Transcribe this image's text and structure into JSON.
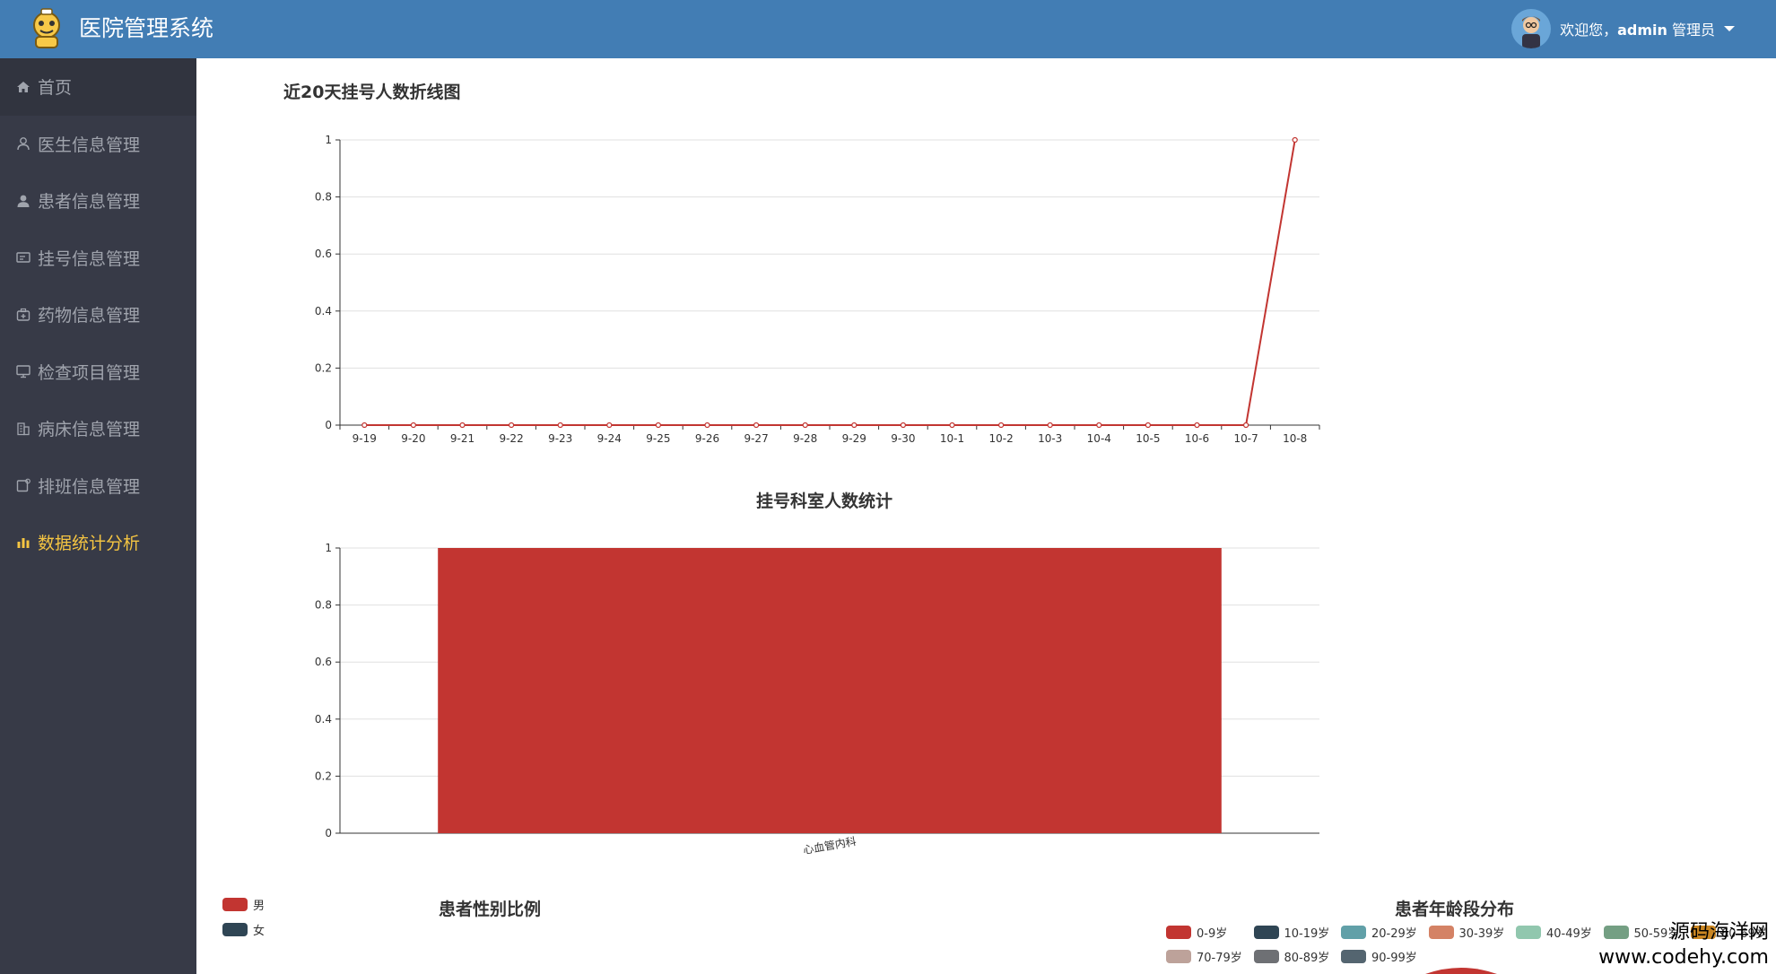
{
  "header": {
    "app_title": "医院管理系统",
    "welcome_prefix": "欢迎您，",
    "username": "admin",
    "role": " 管理员"
  },
  "sidebar": {
    "items": [
      {
        "label": "首页",
        "icon": "home-icon"
      },
      {
        "label": "医生信息管理",
        "icon": "user-outline-icon"
      },
      {
        "label": "患者信息管理",
        "icon": "user-icon"
      },
      {
        "label": "挂号信息管理",
        "icon": "id-card-icon"
      },
      {
        "label": "药物信息管理",
        "icon": "medicine-box-icon"
      },
      {
        "label": "检查项目管理",
        "icon": "monitor-icon"
      },
      {
        "label": "病床信息管理",
        "icon": "building-icon"
      },
      {
        "label": "排班信息管理",
        "icon": "calendar-icon"
      },
      {
        "label": "数据统计分析",
        "icon": "bar-chart-icon"
      }
    ],
    "active_index": 8
  },
  "colors": {
    "header_bg": "#427db4",
    "sidebar_bg": "#373a47",
    "active": "#f5c542",
    "series_red": "#c23531"
  },
  "chart_data": [
    {
      "type": "line",
      "title": "近20天挂号人数折线图",
      "categories": [
        "9-19",
        "9-20",
        "9-21",
        "9-22",
        "9-23",
        "9-24",
        "9-25",
        "9-26",
        "9-27",
        "9-28",
        "9-29",
        "9-30",
        "10-1",
        "10-2",
        "10-3",
        "10-4",
        "10-5",
        "10-6",
        "10-7",
        "10-8"
      ],
      "values": [
        0,
        0,
        0,
        0,
        0,
        0,
        0,
        0,
        0,
        0,
        0,
        0,
        0,
        0,
        0,
        0,
        0,
        0,
        0,
        1
      ],
      "ylim": [
        0,
        1
      ],
      "yticks": [
        "0",
        "0.2",
        "0.4",
        "0.6",
        "0.8",
        "1"
      ],
      "grid": true
    },
    {
      "type": "bar",
      "title": "挂号科室人数统计",
      "categories": [
        "心血管内科"
      ],
      "values": [
        1
      ],
      "ylim": [
        0,
        1
      ],
      "yticks": [
        "0",
        "0.2",
        "0.4",
        "0.6",
        "0.8",
        "1"
      ],
      "grid": true
    },
    {
      "type": "pie",
      "title": "患者性别比例",
      "legend": [
        {
          "label": "男",
          "color": "#c23531"
        },
        {
          "label": "女",
          "color": "#2f4554"
        }
      ],
      "legend_position": "top-left"
    },
    {
      "type": "pie",
      "title": "患者年龄段分布",
      "legend": [
        {
          "label": "0-9岁",
          "color": "#c23531"
        },
        {
          "label": "10-19岁",
          "color": "#2f4554"
        },
        {
          "label": "20-29岁",
          "color": "#61a0a8"
        },
        {
          "label": "30-39岁",
          "color": "#d48265"
        },
        {
          "label": "40-49岁",
          "color": "#91c7ae"
        },
        {
          "label": "50-59岁",
          "color": "#749f83"
        },
        {
          "label": "60-69岁",
          "color": "#ca8622"
        },
        {
          "label": "70-79岁",
          "color": "#bda29a"
        },
        {
          "label": "80-89岁",
          "color": "#6e7074"
        },
        {
          "label": "90-99岁",
          "color": "#546570"
        }
      ],
      "legend_position": "top"
    }
  ],
  "watermark": {
    "line1": "源码海洋网",
    "line2": "www.codehy.com"
  }
}
